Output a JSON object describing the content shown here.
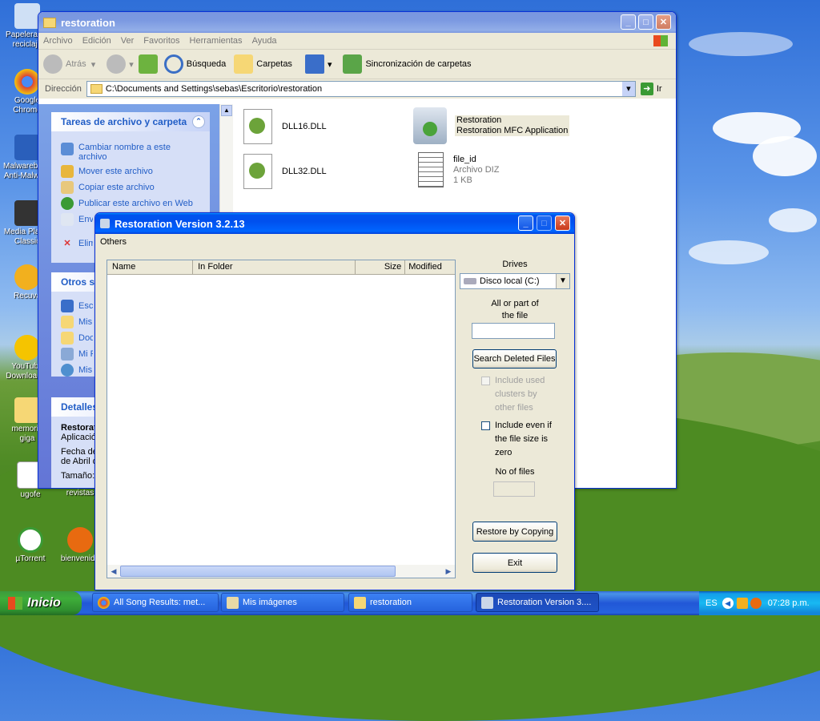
{
  "desktop": {
    "icons": [
      {
        "label": "Papelera de reciclaje"
      },
      {
        "label": "Google Chrome"
      },
      {
        "label": "Malwarebytes Anti-Malware"
      },
      {
        "label": "Media Player Classic"
      },
      {
        "label": "Recuva"
      },
      {
        "label": "YouTube Downloader"
      },
      {
        "label": "memoria giga"
      },
      {
        "label": "ugofe"
      },
      {
        "label": "revistas"
      },
      {
        "label": "µTorrent"
      },
      {
        "label": "bienvenida"
      }
    ]
  },
  "explorer": {
    "title": "restoration",
    "menu": [
      "Archivo",
      "Edición",
      "Ver",
      "Favoritos",
      "Herramientas",
      "Ayuda"
    ],
    "toolbar": {
      "back": "Atrás",
      "search": "Búsqueda",
      "folders": "Carpetas",
      "sync": "Sincronización de carpetas"
    },
    "address": {
      "label": "Dirección",
      "path": "C:\\Documents and Settings\\sebas\\Escritorio\\restoration",
      "go": "Ir"
    },
    "tasks": {
      "title": "Tareas de archivo y carpeta",
      "items": [
        "Cambiar nombre a este archivo",
        "Mover este archivo",
        "Copiar este archivo",
        "Publicar este archivo en Web",
        "Enviar este archivo por correo electrónico",
        "Eliminar este archivo"
      ]
    },
    "other": {
      "title": "Otros sitios",
      "items": [
        "Escritorio",
        "Mis documentos",
        "Documentos compartidos",
        "Mi PC",
        "Mis sitios de red"
      ]
    },
    "details": {
      "title": "Detalles",
      "name": "Restoration",
      "type": "Aplicación",
      "date_label": "Fecha de modificación:",
      "date_value": "de Abril de",
      "size_label": "Tamaño:"
    },
    "files": [
      {
        "name": "DLL16.DLL",
        "line2": "",
        "line3": ""
      },
      {
        "name": "Restoration",
        "line2": "Restoration MFC Application",
        "line3": ""
      },
      {
        "name": "DLL32.DLL",
        "line2": "",
        "line3": ""
      },
      {
        "name": "file_id",
        "line2": "Archivo DIZ",
        "line3": "1 KB"
      }
    ]
  },
  "restoration": {
    "title": "Restoration Version 3.2.13",
    "menu": "Others",
    "columns": [
      "Name",
      "In Folder",
      "Size",
      "Modified"
    ],
    "drives_label": "Drives",
    "drive_selected": "Disco local (C:)",
    "file_label_1": "All or part of",
    "file_label_2": "the file",
    "file_input": "",
    "search_button": "Search Deleted Files",
    "include_used_1": "Include used",
    "include_used_2": "clusters by",
    "include_used_3": "other files",
    "include_zero_1": "Include even if",
    "include_zero_2": "the file size is",
    "include_zero_3": "zero",
    "no_files_label": "No of files",
    "no_files_value": "",
    "restore_button": "Restore by Copying",
    "exit_button": "Exit"
  },
  "taskbar": {
    "start": "Inicio",
    "tasks": [
      {
        "label": "All Song Results: met...",
        "active": false
      },
      {
        "label": "Mis imágenes",
        "active": false
      },
      {
        "label": "restoration",
        "active": false
      },
      {
        "label": "Restoration Version 3....",
        "active": true
      }
    ],
    "lang": "ES",
    "clock": "07:28 p.m."
  }
}
